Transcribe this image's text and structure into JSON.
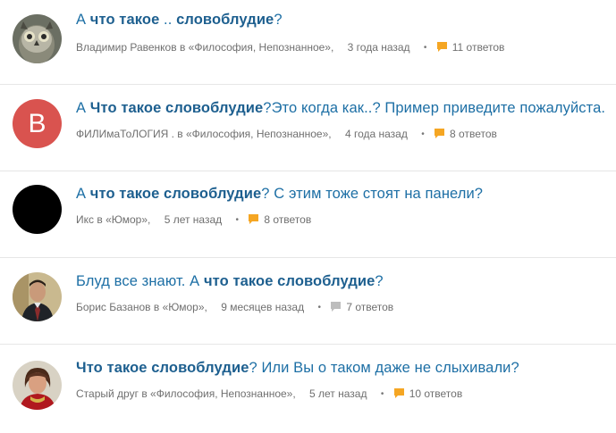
{
  "questions": [
    {
      "title_parts": [
        "А ",
        "что такое",
        " .. ",
        "словоблудие",
        "?"
      ],
      "author": "Владимир Равенков",
      "category": "в «Философия, Непознанное»,",
      "time": "3 года назад",
      "answers": "11 ответов",
      "answer_icon_color": "#f5a623",
      "avatar": "owl-photo-avatar"
    },
    {
      "title_parts": [
        "А ",
        "Что такое словоблудие",
        "?Это когда как..? Пример приведите пожалуйста."
      ],
      "author": "ФИЛИмаТоЛОГИЯ .",
      "category": "в «Философия, Непознанное»,",
      "time": "4 года назад",
      "answers": "8 ответов",
      "answer_icon_color": "#f5a623",
      "avatar_letter": "B",
      "avatar_color": "#d9534f"
    },
    {
      "title_parts": [
        "А ",
        "что такое словоблудие",
        "? С этим тоже стоят на панели?"
      ],
      "author": "Икс",
      "category": "в «Юмор»,",
      "time": "5 лет назад",
      "answers": "8 ответов",
      "answer_icon_color": "#f5a623",
      "avatar_color": "#000000"
    },
    {
      "title_parts": [
        "Блуд все знают. А ",
        "что такое словоблудие",
        "?"
      ],
      "author": "Борис Базанов",
      "category": "в «Юмор»,",
      "time": "9 месяцев назад",
      "answers": "7 ответов",
      "answer_icon_color": "#bdbdbd",
      "avatar": "man-photo-avatar"
    },
    {
      "title_parts": [
        "",
        "Что такое словоблудие",
        "? Или Вы о таком даже не слыхивали?"
      ],
      "author": "Старый друг",
      "category": "в «Философия, Непознанное»,",
      "time": "5 лет назад",
      "answers": "10 ответов",
      "answer_icon_color": "#f5a623",
      "avatar": "woman-photo-avatar"
    }
  ],
  "separator_dot": "•"
}
